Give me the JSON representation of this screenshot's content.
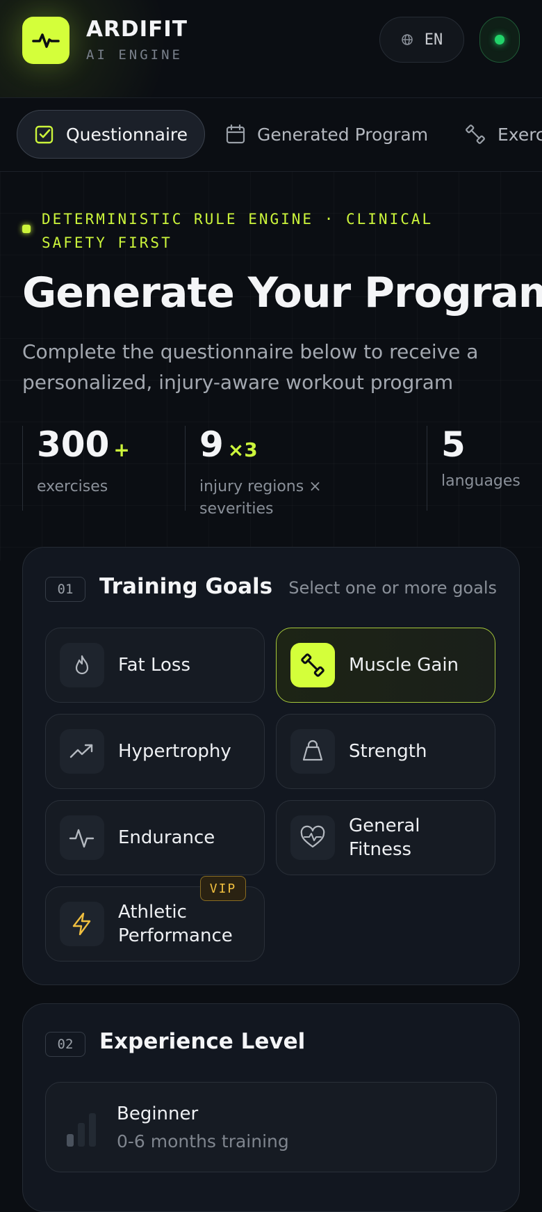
{
  "header": {
    "brand_name": "ARDIFIT",
    "brand_sub": "AI ENGINE",
    "language": "EN"
  },
  "tabs": [
    {
      "label": "Questionnaire",
      "icon": "checkbox-icon",
      "active": true
    },
    {
      "label": "Generated Program",
      "icon": "calendar-icon",
      "active": false
    },
    {
      "label": "Exercises",
      "icon": "dumbbell-icon",
      "active": false
    }
  ],
  "hero": {
    "kicker": "DETERMINISTIC RULE ENGINE · CLINICAL SAFETY FIRST",
    "title": "Generate Your Program",
    "subtitle": "Complete the questionnaire below to receive a personalized, injury-aware workout program"
  },
  "stats": [
    {
      "value": "300",
      "suffix": "+",
      "label": "exercises"
    },
    {
      "value": "9",
      "suffix": "×3",
      "label": "injury regions × severities"
    },
    {
      "value": "5",
      "suffix": "",
      "label": "languages"
    }
  ],
  "goals": {
    "step": "01",
    "title": "Training Goals",
    "hint": "Select one or more goals",
    "options": [
      {
        "label": "Fat Loss",
        "icon": "flame-icon",
        "selected": false
      },
      {
        "label": "Muscle Gain",
        "icon": "dumbbell-icon",
        "selected": true
      },
      {
        "label": "Hypertrophy",
        "icon": "trending-up-icon",
        "selected": false
      },
      {
        "label": "Strength",
        "icon": "kettlebell-icon",
        "selected": false
      },
      {
        "label": "Endurance",
        "icon": "pulse-icon",
        "selected": false
      },
      {
        "label": "General Fitness",
        "icon": "heart-pulse-icon",
        "selected": false
      },
      {
        "label": "Athletic Performance",
        "icon": "lightning-icon",
        "selected": false,
        "badge": "VIP"
      }
    ]
  },
  "experience": {
    "step": "02",
    "title": "Experience Level",
    "levels": [
      {
        "name": "Beginner",
        "desc": "0-6 months training",
        "icon": "signal-bars-icon"
      }
    ]
  },
  "colors": {
    "accent": "#d4ff3a",
    "status": "#22d36a",
    "vip": "#f0bf3f"
  }
}
